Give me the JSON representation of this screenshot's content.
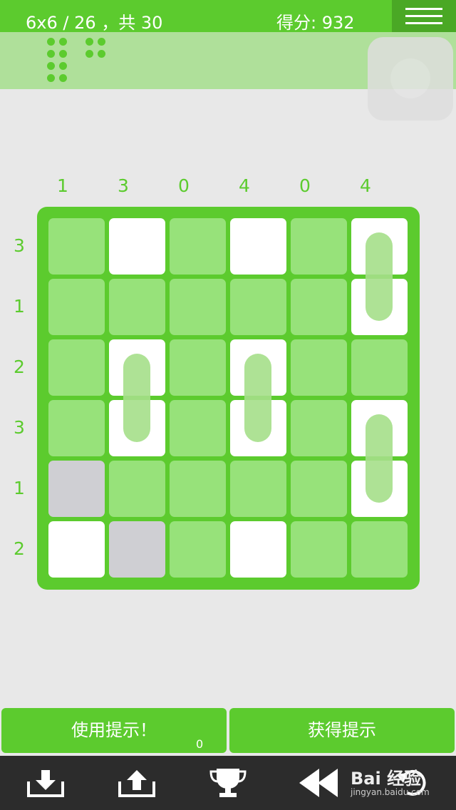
{
  "header": {
    "level": "6x6 / 26 ，共 30",
    "score": "得分: 932",
    "menu_icon": "hamburger-menu-icon"
  },
  "board": {
    "size": 6,
    "column_clues": [
      "1",
      "3",
      "0",
      "4",
      "0",
      "4"
    ],
    "row_clues": [
      "3",
      "1",
      "2",
      "3",
      "1",
      "2"
    ],
    "cells": [
      [
        "empty",
        "filled-green",
        "empty",
        "filled-green",
        "empty",
        "filled-gray"
      ],
      [
        "empty",
        "empty",
        "empty",
        "empty",
        "empty",
        "filled-green"
      ],
      [
        "empty",
        "filled-green",
        "empty",
        "filled-green",
        "empty",
        "empty"
      ],
      [
        "empty",
        "filled-green",
        "empty",
        "filled-green",
        "empty",
        "filled-green"
      ],
      [
        "blocked",
        "empty",
        "empty",
        "empty",
        "empty",
        "filled-gray"
      ],
      [
        "filled-green",
        "blocked",
        "empty",
        "filled-green",
        "empty",
        "empty"
      ]
    ],
    "colors": {
      "board": "#5ccb2e",
      "empty": "#97e27a",
      "filled": "#ffffff",
      "blocked": "#cfcfd3",
      "dot": "#4fcb1e",
      "dot_inactive": "#cacacf"
    }
  },
  "buttons": {
    "use_hint": "使用提示！",
    "hint_count": "0",
    "get_hint": "获得提示"
  },
  "toolbar": {
    "icons": [
      "download-icon",
      "upload-icon",
      "trophy-icon",
      "rewind-icon",
      "undo-icon"
    ]
  },
  "watermark": {
    "text": "Bai 经验",
    "sub": "jingyan.baidu.com"
  }
}
